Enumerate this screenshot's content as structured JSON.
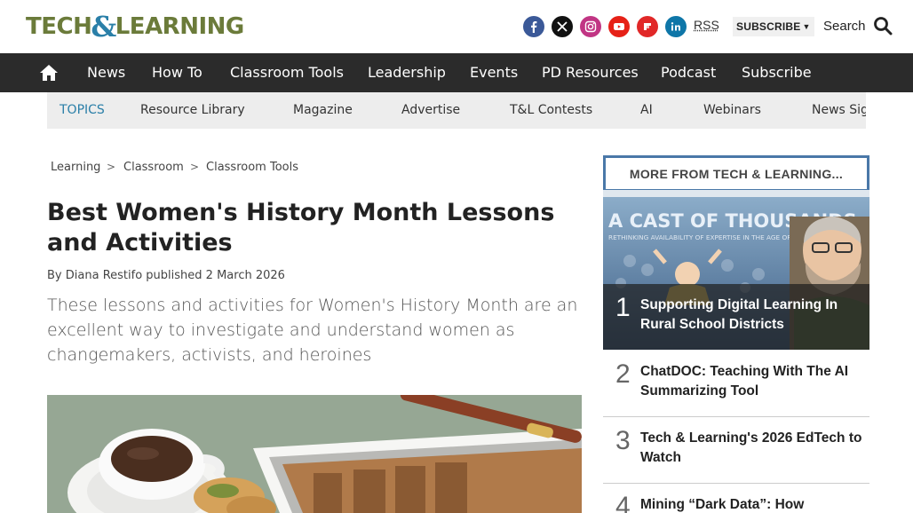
{
  "brand": {
    "logo_part1": "TECH",
    "logo_amp": "&",
    "logo_part2": "LEARNING",
    "logo_color": "#6b7b3a",
    "amp_color": "#2a7fa8"
  },
  "header": {
    "social": [
      {
        "name": "facebook",
        "icon": "facebook-icon",
        "color": "#3b5998"
      },
      {
        "name": "x",
        "icon": "x-icon",
        "color": "#111111"
      },
      {
        "name": "instagram",
        "icon": "instagram-icon",
        "color": "#c13584"
      },
      {
        "name": "youtube",
        "icon": "youtube-icon",
        "color": "#e62117"
      },
      {
        "name": "flipboard",
        "icon": "flipboard-icon",
        "color": "#e12828"
      },
      {
        "name": "linkedin",
        "icon": "linkedin-icon",
        "color": "#0e76a8"
      }
    ],
    "rss_label": "RSS",
    "subscribe_label": "SUBSCRIBE",
    "search_label": "Search"
  },
  "nav": {
    "items": [
      "News",
      "How To",
      "Classroom Tools",
      "Leadership",
      "Events",
      "PD Resources",
      "Podcast",
      "Subscribe"
    ]
  },
  "topics": {
    "label": "TOPICS",
    "items": [
      "Resource Library",
      "Magazine",
      "Advertise",
      "T&L Contests",
      "AI",
      "Webinars",
      "News Sig"
    ]
  },
  "breadcrumb": [
    "Learning",
    "Classroom",
    "Classroom Tools"
  ],
  "breadcrumb_sep": ">",
  "article": {
    "title": "Best Women's History Month Lessons and Activities",
    "by_label": "By",
    "author": "Diana Restifo",
    "published_label": "published",
    "date": "2 March 2026",
    "standfirst": "These lessons and activities for Women's History Month are an excellent way to investigate and understand women as changemakers, activists, and heroines"
  },
  "sidebar": {
    "heading": "MORE FROM TECH & LEARNING...",
    "image_banner_title": "A CAST OF THOUSANDS",
    "image_banner_subtitle": "RETHINKING AVAILABILITY OF EXPERTISE IN THE AGE OF AI",
    "items": [
      {
        "rank": "1",
        "title": "Supporting Digital Learning In Rural School Districts"
      },
      {
        "rank": "2",
        "title": "ChatDOC: Teaching With The AI Summarizing Tool"
      },
      {
        "rank": "3",
        "title": "Tech & Learning's 2026 EdTech to Watch"
      },
      {
        "rank": "4",
        "title": "Mining “Dark Data”: How"
      }
    ]
  }
}
